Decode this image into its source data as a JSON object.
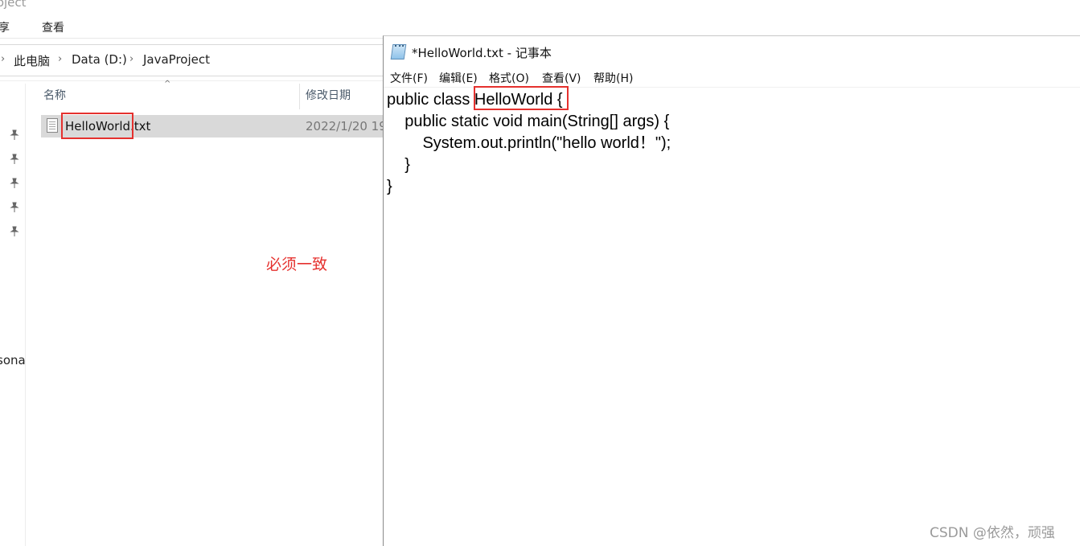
{
  "explorer": {
    "title_fragment": "roject",
    "ribbon": {
      "share_fragment": "享",
      "view": "查看"
    },
    "address": {
      "segments": [
        "此电脑",
        "Data (D:)",
        "JavaProject"
      ]
    },
    "columns": {
      "name": "名称",
      "modified": "修改日期"
    },
    "nav_partial_label": "sona",
    "files": [
      {
        "name": "HelloWorld.txt",
        "modified_partial": "2022/1/20 19"
      }
    ]
  },
  "annotation": "必须一致",
  "notepad": {
    "title": "*HelloWorld.txt - 记事本",
    "menu": [
      "文件(F)",
      "编辑(E)",
      "格式(O)",
      "查看(V)",
      "帮助(H)"
    ],
    "code_lines": [
      "public class HelloWorld {",
      "    public static void main(String[] args) {",
      "        System.out.println(\"hello world！\");",
      "    }",
      "}"
    ]
  },
  "watermark": "CSDN @依然，顽强"
}
